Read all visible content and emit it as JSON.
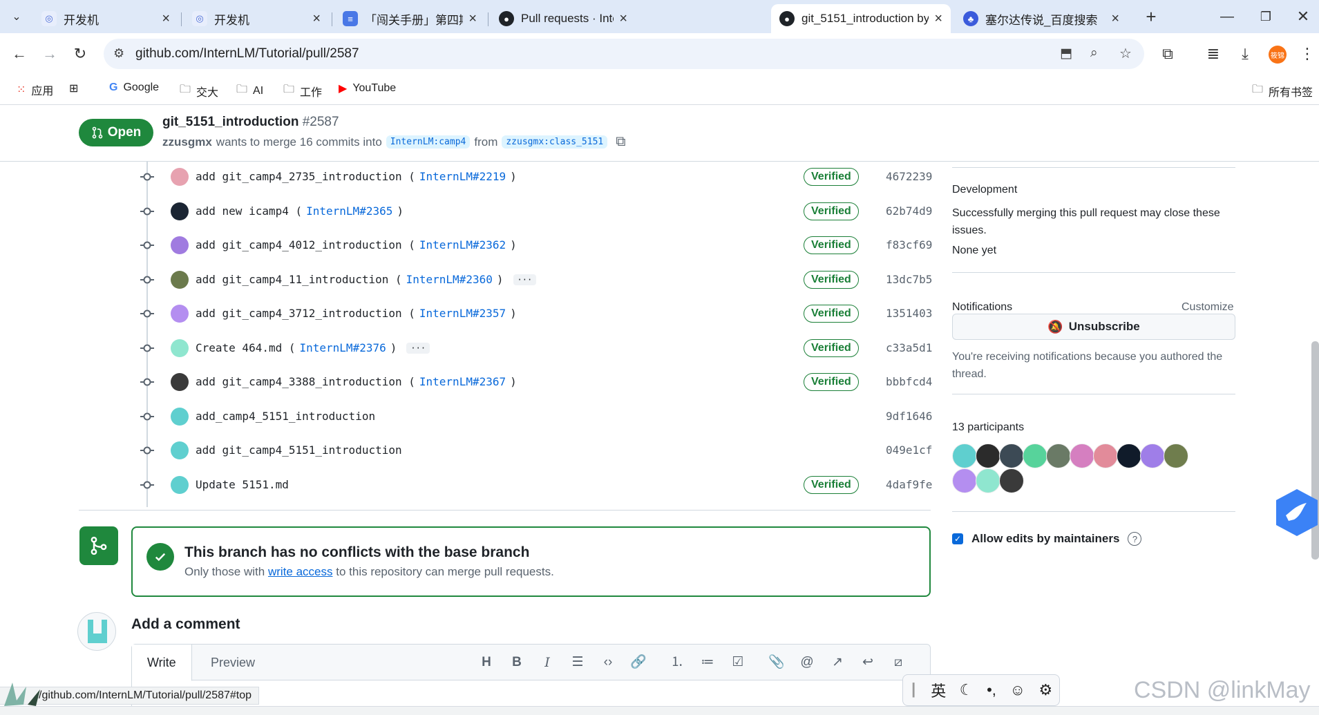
{
  "browser": {
    "tabs": [
      {
        "title": "开发机",
        "icon": "devmachine-icon"
      },
      {
        "title": "开发机",
        "icon": "devmachine-icon"
      },
      {
        "title": "「闯关手册」第四期书生大",
        "icon": "doc-icon"
      },
      {
        "title": "Pull requests · InternLM/",
        "icon": "github-icon"
      },
      {
        "title": "git_5151_introduction by",
        "icon": "github-icon"
      },
      {
        "title": "塞尔达传说_百度搜索",
        "icon": "baidu-icon"
      }
    ],
    "address": "github.com/InternLM/Tutorial/pull/2587",
    "profile_label": "筱锦",
    "bookmarks": [
      "应用",
      "Google",
      "交大",
      "AI",
      "工作",
      "YouTube"
    ],
    "all_bookmarks": "所有书签"
  },
  "pr": {
    "state": "Open",
    "title": "git_5151_introduction",
    "number": "#2587",
    "author": "zzusgmx",
    "merge_text": "wants to merge 16 commits into",
    "base": "InternLM:camp4",
    "from_word": "from",
    "head": "zzusgmx:class_5151"
  },
  "commits": [
    {
      "message": "add git_camp4_2735_introduction (",
      "ref": "InternLM#2219",
      "close": ")",
      "ellipsis": false,
      "verified": "Verified",
      "sha": "4672239",
      "avatar": "#e7a2b0"
    },
    {
      "message": "add new icamp4 (",
      "ref": "InternLM#2365",
      "close": ")",
      "ellipsis": false,
      "verified": "Verified",
      "sha": "62b74d9",
      "avatar": "#1b2533"
    },
    {
      "message": "add git_camp4_4012_introduction (",
      "ref": "InternLM#2362",
      "close": ")",
      "ellipsis": false,
      "verified": "Verified",
      "sha": "f83cf69",
      "avatar": "#a07be0"
    },
    {
      "message": "add git_camp4_11_introduction (",
      "ref": "InternLM#2360",
      "close": ")",
      "ellipsis": true,
      "verified": "Verified",
      "sha": "13dc7b5",
      "avatar": "#6b7a4c"
    },
    {
      "message": "add git_camp4_3712_introduction (",
      "ref": "InternLM#2357",
      "close": ")",
      "ellipsis": false,
      "verified": "Verified",
      "sha": "1351403",
      "avatar": "#b48ef0"
    },
    {
      "message": "Create 464.md (",
      "ref": "InternLM#2376",
      "close": ")",
      "ellipsis": true,
      "verified": "Verified",
      "sha": "c33a5d1",
      "avatar": "#8fe6cf"
    },
    {
      "message": "add git_camp4_3388_introduction (",
      "ref": "InternLM#2367",
      "close": ")",
      "ellipsis": false,
      "verified": "Verified",
      "sha": "bbbfcd4",
      "avatar": "#3a3a3a"
    },
    {
      "message": "add_camp4_5151_introduction",
      "ref": "",
      "close": "",
      "ellipsis": false,
      "verified": "",
      "sha": "9df1646",
      "avatar": "#5fcfcf"
    },
    {
      "message": "add git_camp4_5151_introduction",
      "ref": "",
      "close": "",
      "ellipsis": false,
      "verified": "",
      "sha": "049e1cf",
      "avatar": "#5fcfcf"
    },
    {
      "message": "Update 5151.md",
      "ref": "",
      "close": "",
      "ellipsis": false,
      "verified": "Verified",
      "sha": "4daf9fe",
      "avatar": "#5fcfcf"
    }
  ],
  "merge": {
    "title": "This branch has no conflicts with the base branch",
    "desc_before": "Only those with",
    "desc_link": "write access",
    "desc_after": "to this repository can merge pull requests."
  },
  "comment": {
    "heading": "Add a comment",
    "tab_write": "Write",
    "tab_preview": "Preview"
  },
  "sidebar": {
    "development_title": "Development",
    "development_text": "Successfully merging this pull request may close these issues.",
    "none_yet": "None yet",
    "notifications_title": "Notifications",
    "customize": "Customize",
    "unsubscribe": "Unsubscribe",
    "notify_reason": "You're receiving notifications because you authored the thread.",
    "participants_title": "13 participants",
    "participant_colors": [
      "#5fcfcf",
      "#2b2b2b",
      "#3c4a55",
      "#57d39b",
      "#6a7a66",
      "#d57fc0",
      "#e28b9a",
      "#101b2a",
      "#9f7ee8",
      "#6f7d4d",
      "#b48ef0",
      "#8fe6cf",
      "#3a3a3a"
    ],
    "allow_edits": "Allow edits by maintainers"
  },
  "status_url": "/github.com/InternLM/Tutorial/pull/2587#top",
  "ime_label": "英",
  "watermark": "CSDN @linkMay"
}
